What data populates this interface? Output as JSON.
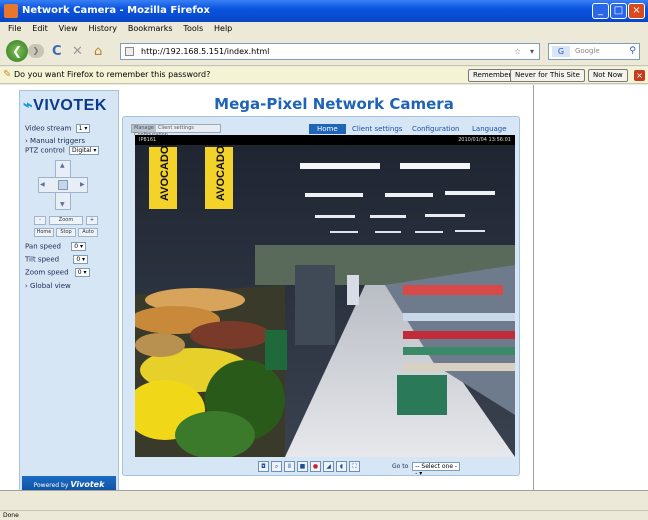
{
  "window": {
    "title": "Network Camera - Mozilla Firefox",
    "min": "_",
    "max": "□",
    "close": "×"
  },
  "menu": [
    "File",
    "Edit",
    "View",
    "History",
    "Bookmarks",
    "Tools",
    "Help"
  ],
  "nav": {
    "back": "❮",
    "forward": "❯",
    "reload": "C",
    "stop": "✕",
    "home": "⌂",
    "url": "http://192.168.5.151/index.html",
    "star": "☆",
    "dropdown": "▾",
    "search_placeholder": "Google",
    "search_engine": "G"
  },
  "notification": {
    "message": "Do you want Firefox to remember this password?",
    "buttons": [
      "Remember",
      "Never for This Site",
      "Not Now"
    ],
    "close": "×"
  },
  "sidebar": {
    "logo": "VIVOTEK",
    "video_stream_label": "Video stream",
    "video_stream_value": "1",
    "manual_triggers": "Manual triggers",
    "ptz_control_label": "PTZ control",
    "ptz_control_value": "Digital",
    "zoom_buttons": [
      "-",
      "Zoom",
      "+"
    ],
    "focus_buttons": [
      "Home",
      "Stop",
      "Auto"
    ],
    "pan_speed_label": "Pan speed",
    "tilt_speed_label": "Tilt speed",
    "zoom_speed_label": "Zoom speed",
    "speed_value": "0",
    "global_view": "Global view",
    "powered_by": "Powered by",
    "powered_brand": "Vivotek"
  },
  "header": {
    "title": "Mega-Pixel Network Camera"
  },
  "tabs": {
    "mini": [
      "Manage",
      "Client settings",
      "Configuration"
    ],
    "home": "Home",
    "client_settings": "Client settings",
    "configuration": "Configuration",
    "language": "Language"
  },
  "video": {
    "overlay_left": "IP8161",
    "overlay_right": "2010/01/04 13:56:01",
    "banner_1": "AVOCADO",
    "banner_2": "AVOCADO"
  },
  "toolbar": {
    "go_to_label": "Go to",
    "go_to_value": "-- Select one --",
    "icons": [
      "snapshot-icon",
      "digital-zoom-icon",
      "pause-icon",
      "stop-icon",
      "record-icon",
      "volume-icon",
      "mic-icon",
      "fullscreen-icon"
    ]
  },
  "status_bar": {
    "text": "Done"
  }
}
